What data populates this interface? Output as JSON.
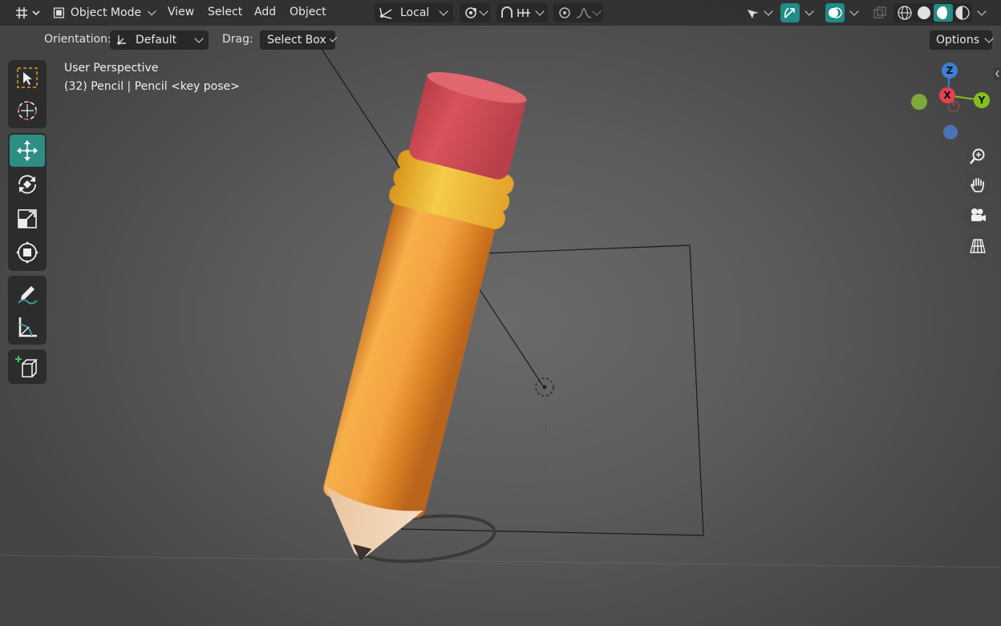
{
  "header": {
    "editor_type_icon": "grid-axis-icon",
    "mode": "Object Mode",
    "menus": [
      "View",
      "Select",
      "Add",
      "Object"
    ],
    "transform_orientation": "Local",
    "snap_icon": "magnet-icon",
    "proportional_icon": "proportional-editing-icon",
    "shading_modes": [
      "wireframe",
      "solid",
      "material-preview",
      "rendered"
    ],
    "active_shading": "material-preview"
  },
  "tool_settings": {
    "orientation_label": "Orientation:",
    "orientation_value": "Default",
    "drag_label": "Drag:",
    "drag_value": "Select Box",
    "options_label": "Options"
  },
  "viewport_info": {
    "perspective": "User Perspective",
    "object_info": "(32) Pencil | Pencil <key pose>"
  },
  "toolbar": {
    "tools": [
      "select-box",
      "cursor",
      "move",
      "rotate",
      "scale",
      "transform",
      "annotate",
      "measure",
      "add-cube"
    ],
    "active_tool": "move"
  },
  "gizmo": {
    "axes": [
      "Z",
      "X",
      "Y"
    ]
  },
  "colors": {
    "accent": "#1f8c86",
    "x_axis": "#e5404f",
    "y_axis": "#84c01d",
    "z_axis": "#3a7fd6",
    "pencil_body": "#f0a040",
    "eraser": "#cc4d55",
    "ferrule": "#f0b820"
  }
}
